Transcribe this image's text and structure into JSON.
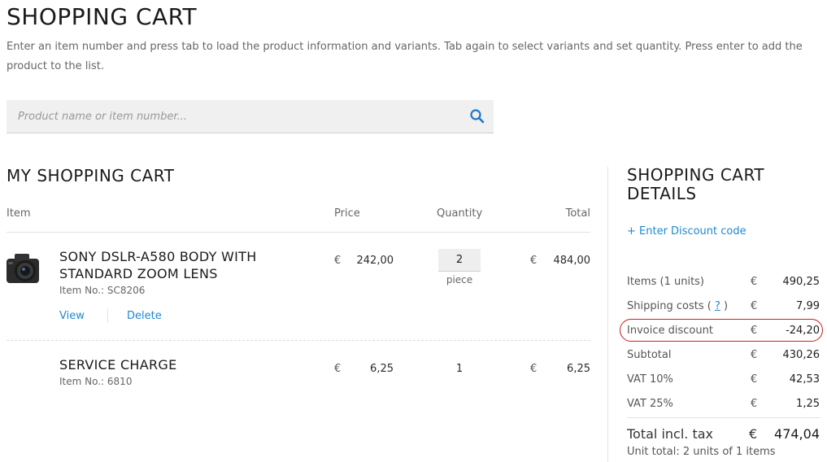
{
  "header": {
    "title": "SHOPPING CART",
    "intro": "Enter an item number and press tab to load the product information and variants. Tab again to select variants and set quantity. Press enter to add the product to the list."
  },
  "search": {
    "placeholder": "Product name or item number...",
    "value": ""
  },
  "cart": {
    "title": "MY SHOPPING CART",
    "columns": {
      "item": "Item",
      "price": "Price",
      "quantity": "Quantity",
      "total": "Total"
    },
    "currency": "€",
    "items": [
      {
        "name": "SONY DSLR-A580 BODY WITH STANDARD ZOOM LENS",
        "item_no_label": "Item No.: SC8206",
        "price": "242,00",
        "quantity": "2",
        "unit": "piece",
        "total": "484,00",
        "view_label": "View",
        "delete_label": "Delete",
        "image_icon": "camera-icon"
      },
      {
        "name": "SERVICE CHARGE",
        "item_no_label": "Item No.: 6810",
        "price": "6,25",
        "quantity": "1",
        "total": "6,25"
      }
    ]
  },
  "details": {
    "title_line1": "SHOPPING CART",
    "title_line2": "DETAILS",
    "discount_link": "+ Enter Discount code",
    "currency": "€",
    "rows": [
      {
        "label": "Items (1 units)",
        "value": "490,25"
      },
      {
        "label_pre": "Shipping costs (",
        "help": "?",
        "label_post": ")",
        "value": "7,99"
      },
      {
        "label": "Invoice discount",
        "value": "-24,20"
      },
      {
        "label": "Subtotal",
        "value": "430,26"
      },
      {
        "label": "VAT 10%",
        "value": "42,53"
      },
      {
        "label": "VAT 25%",
        "value": "1,25"
      }
    ],
    "total_label": "Total incl. tax",
    "total_value": "474,04",
    "unit_total": "Unit total: 2 units of 1 items"
  },
  "colors": {
    "accent": "#1e88d4",
    "highlight": "#d01b1b",
    "search_bg": "#f0f0f0"
  }
}
